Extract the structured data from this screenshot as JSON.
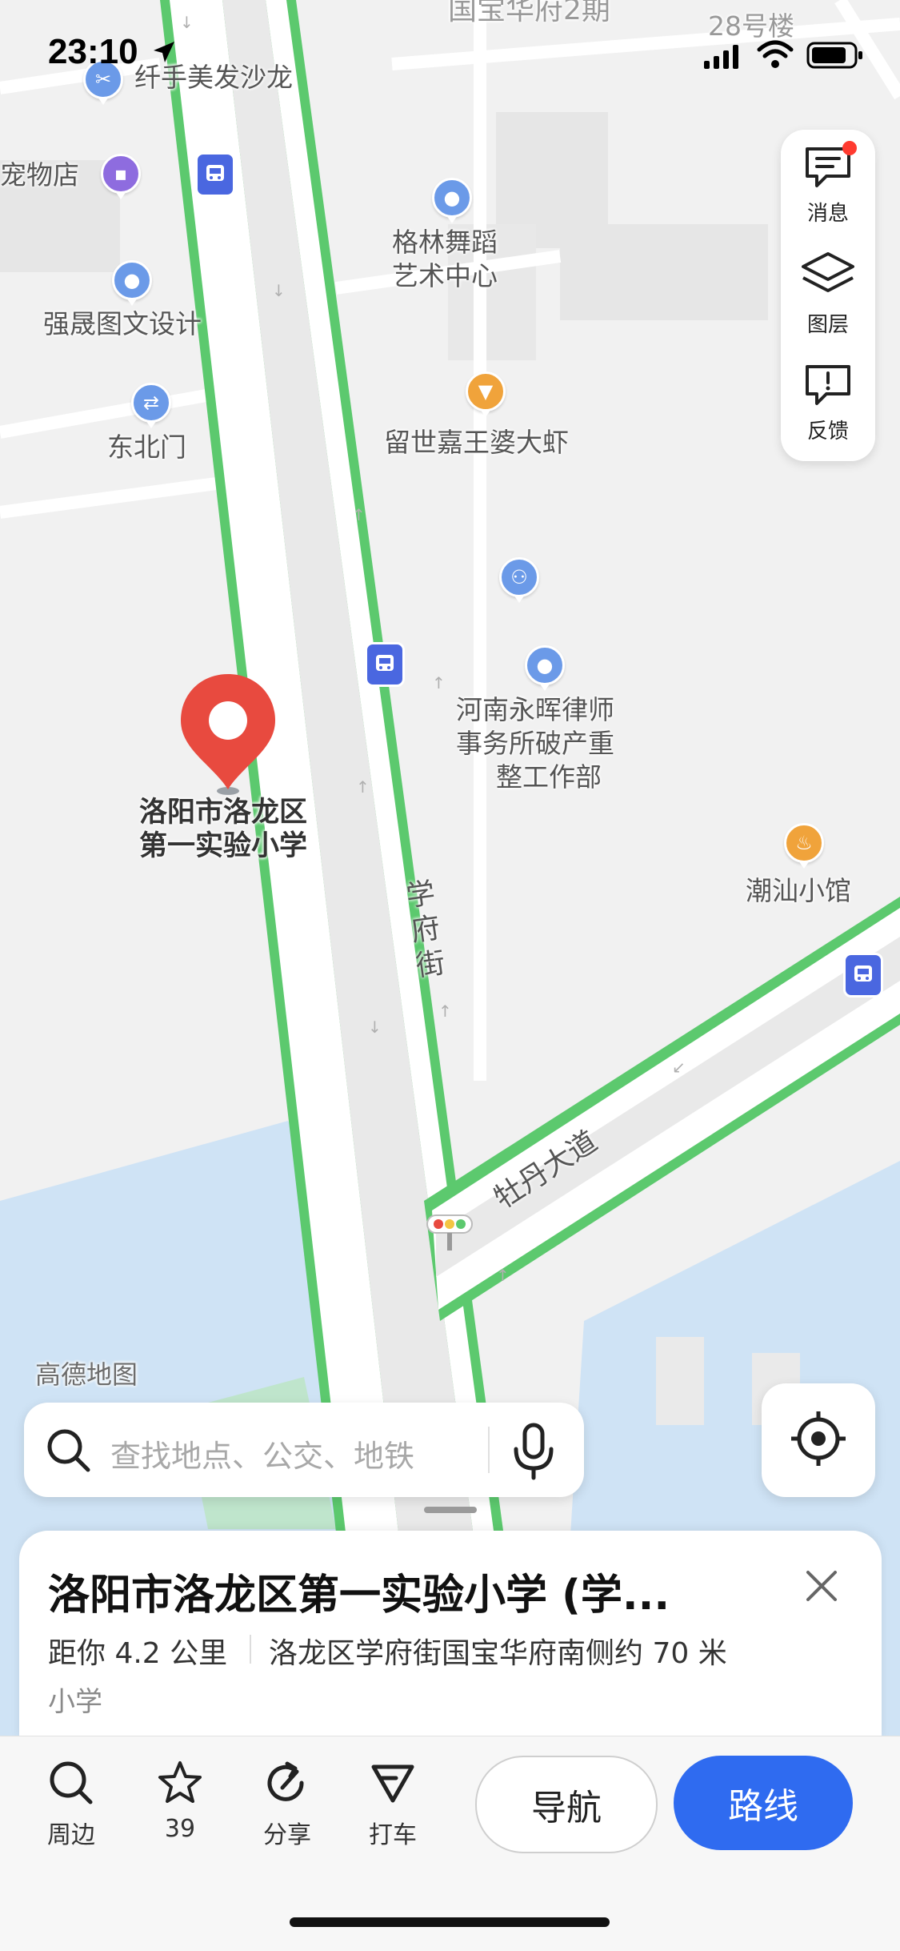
{
  "status_bar": {
    "time": "23:10"
  },
  "map": {
    "watermark": "高德地图",
    "pois": {
      "building_top": "国宝华府2期",
      "building_28": "28号楼",
      "salon": "纤手美发沙龙",
      "pet_store": "宠物店",
      "gelin_line1": "格林舞蹈",
      "gelin_line2": "艺术中心",
      "qiangsheng": "强晟图文设计",
      "northeast_gate": "东北门",
      "shrimp": "留世嘉王婆大虾",
      "law_line1": "河南永晖律师",
      "law_line2": "事务所破产重",
      "law_line3": "整工作部",
      "school_line1": "洛阳市洛龙区",
      "school_line2": "第一实验小学",
      "chaoshan": "潮汕小馆"
    },
    "roads": {
      "xuefu_street": "学府街",
      "mudan_avenue": "牡丹大道"
    }
  },
  "side_panel": {
    "messages": "消息",
    "layers": "图层",
    "feedback": "反馈"
  },
  "search": {
    "placeholder": "查找地点、公交、地铁"
  },
  "place_card": {
    "title": "洛阳市洛龙区第一实验小学 (学...",
    "distance": "距你 4.2 公里",
    "address": "洛龙区学府街国宝华府南侧约 70 米",
    "category": "小学"
  },
  "bottom_bar": {
    "nearby": "周边",
    "favorites_count": "39",
    "share": "分享",
    "taxi": "打车",
    "navigate": "导航",
    "route": "路线"
  },
  "colors": {
    "road_border": "#5cc96e",
    "bus_icon": "#4a67e0",
    "poi_blue": "#6b9ae8",
    "poi_orange": "#f0a33b",
    "pin_red": "#e84a3f",
    "route_button": "#2f6bf0",
    "water": "#cfe3f5"
  }
}
